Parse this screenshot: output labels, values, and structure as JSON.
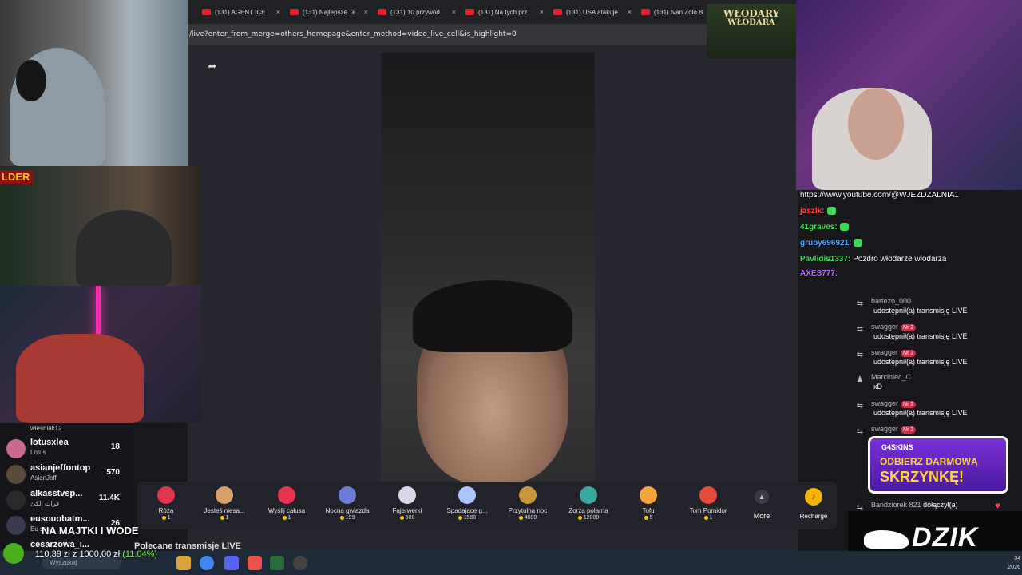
{
  "browser": {
    "tabs": [
      {
        "title": "(131) AGENT ICE"
      },
      {
        "title": "(131) Najlepsze Te"
      },
      {
        "title": "(131) 10 przywód"
      },
      {
        "title": "(131) Na tych prz"
      },
      {
        "title": "(131) USA atakuje"
      },
      {
        "title": "(131) Ivan Zolo B"
      }
    ],
    "close_glyph": "×",
    "url": "/live?enter_from_merge=others_homepage&enter_method=video_live_cell&is_highlight=0"
  },
  "top_overlay": {
    "line1": "WŁODARY",
    "line2": "WŁODARA"
  },
  "cam2_tag": "LDER",
  "stream_chat": [
    {
      "text": "https://www.youtube.com/@WJEZDZALNIA1",
      "color": "#ffffff"
    },
    {
      "name": "jaszlk:",
      "color": "#ff4444",
      "emote": true
    },
    {
      "name": "41graves:",
      "color": "#3fd95a",
      "emote": true
    },
    {
      "name": "gruby696921:",
      "color": "#4aa3ff",
      "emote": true
    },
    {
      "name": "Pavlidis1337:",
      "color": "#3fd95a",
      "message": "Pozdro włodarze włodarza"
    },
    {
      "name": "AXES777:",
      "color": "#b56bff"
    }
  ],
  "tiktok_chat": [
    {
      "name": "bartezo_000",
      "message": "udostępnił(a) transmisję LIVE",
      "icon": "share-icon"
    },
    {
      "name": "swagger",
      "badge": "Nr 2",
      "message": "udostępnił(a) transmisję LIVE",
      "icon": "share-icon"
    },
    {
      "name": "swagger",
      "badge": "Nr 3",
      "message": "udostępnił(a) transmisję LIVE",
      "icon": "share-icon"
    },
    {
      "name": "Marciniec_C",
      "message": "xD",
      "icon": "user-icon"
    },
    {
      "name": "swagger",
      "badge": "Nr 3",
      "message": "udostępnił(a) transmisję LIVE",
      "icon": "share-icon"
    },
    {
      "name": "swagger",
      "badge": "Nr 3",
      "message": "",
      "icon": "share-icon"
    }
  ],
  "join_event": {
    "name": "Bandziorek 821",
    "badge": "",
    "message": "dołączył(a)"
  },
  "promo": {
    "brand": "G4SKINS",
    "line1": "ODBIERZ DARMOWĄ",
    "line2": "SKRZYNKĘ!"
  },
  "sponsor": {
    "logo_text": "DZIK"
  },
  "donation_list": [
    {
      "name": "wiesniak12",
      "sub": "",
      "count": "",
      "color": "#6a6a6a"
    },
    {
      "name": "lotusxlea",
      "sub": "Lotus",
      "count": "18",
      "color": "#c96a8c"
    },
    {
      "name": "asianjeffontop",
      "sub": "AsianJeff",
      "count": "570",
      "color": "#5a4a3a"
    },
    {
      "name": "alkasstvsp...",
      "sub": "قرات الكئ",
      "count": "11.4K",
      "color": "#2a2a2a"
    },
    {
      "name": "eusouobatm...",
      "sub": "Eu sou...",
      "count": "26",
      "color": "#3a3a50"
    },
    {
      "name": "cesarzowa_i...",
      "sub": "",
      "count": "",
      "color": "#7a5a4a"
    }
  ],
  "goal": {
    "title": "NA MAJTKI I WODE",
    "amount": "110,39 zł z 1000,00 zł",
    "percent": "(11.04%)",
    "progress": 0.1104
  },
  "gifts": [
    {
      "name": "Róża",
      "price": "1",
      "color": "#e0344f"
    },
    {
      "name": "Jesteś niesa...",
      "price": "1",
      "color": "#d8a16a"
    },
    {
      "name": "Wyślij całusa",
      "price": "1",
      "color": "#e8334c"
    },
    {
      "name": "Nocna gwiazda",
      "price": "199",
      "color": "#6c7dd6"
    },
    {
      "name": "Fajerwerki",
      "price": "500",
      "color": "#d8d8e8"
    },
    {
      "name": "Spadające g...",
      "price": "1580",
      "color": "#a9c4ff"
    },
    {
      "name": "Przytulna noc",
      "price": "4000",
      "color": "#c8963a"
    },
    {
      "name": "Zorza polarna",
      "price": "12000",
      "color": "#3aa8a0"
    },
    {
      "name": "Tofu",
      "price": "5",
      "color": "#f4a23a"
    },
    {
      "name": "Tom Pomidor",
      "price": "1",
      "color": "#e84a3a"
    }
  ],
  "more_label": "More",
  "recharge_label": "Recharge",
  "recommended_label": "Polecane transmisje LIVE",
  "taskbar": {
    "search_placeholder": "Wyszukaj",
    "time": "34",
    "date": ".2026"
  }
}
